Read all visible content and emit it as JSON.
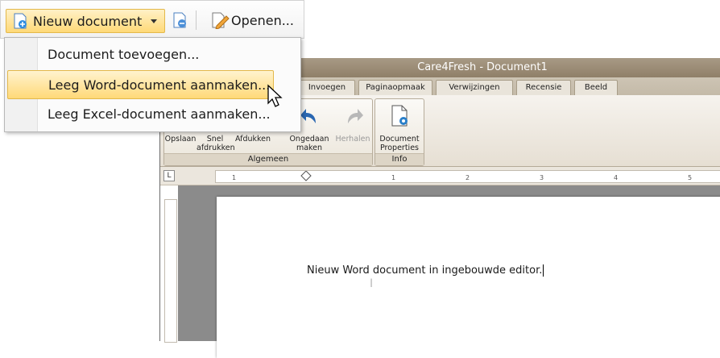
{
  "toolbar": {
    "new_document": "Nieuw document",
    "open": "Openen..."
  },
  "menu": {
    "items": [
      {
        "label": "Document toevoegen..."
      },
      {
        "label": "Leeg Word-document aanmaken..."
      },
      {
        "label": "Leeg Excel-document aanmaken..."
      }
    ]
  },
  "window": {
    "title": "Care4Fresh - Document1"
  },
  "tabs": [
    "Invoegen",
    "Paginaopmaak",
    "Verwijzingen",
    "Recensie",
    "Beeld"
  ],
  "ribbon": {
    "general": {
      "buttons": [
        "Opslaan",
        "Snel afdrukken",
        "Afdukken",
        "Ongedaan maken",
        "Herhalen"
      ],
      "label": "Algemeen"
    },
    "info": {
      "buttons": [
        "Document Properties"
      ],
      "label": "Info"
    }
  },
  "ruler": {
    "corner": "L",
    "numbers": [
      "1",
      "1",
      "2",
      "3",
      "4",
      "5"
    ]
  },
  "document": {
    "text": "Nieuw Word document in ingebouwde editor."
  },
  "icon_names": [
    "new-document-icon",
    "remove-document-icon",
    "open-document-icon",
    "undo-icon",
    "redo-icon",
    "document-properties-icon",
    "mouse-cursor-icon"
  ],
  "colors": {
    "highlight": "#ffd977",
    "title_bar": "#978770",
    "workspace": "#8b8b8b"
  }
}
